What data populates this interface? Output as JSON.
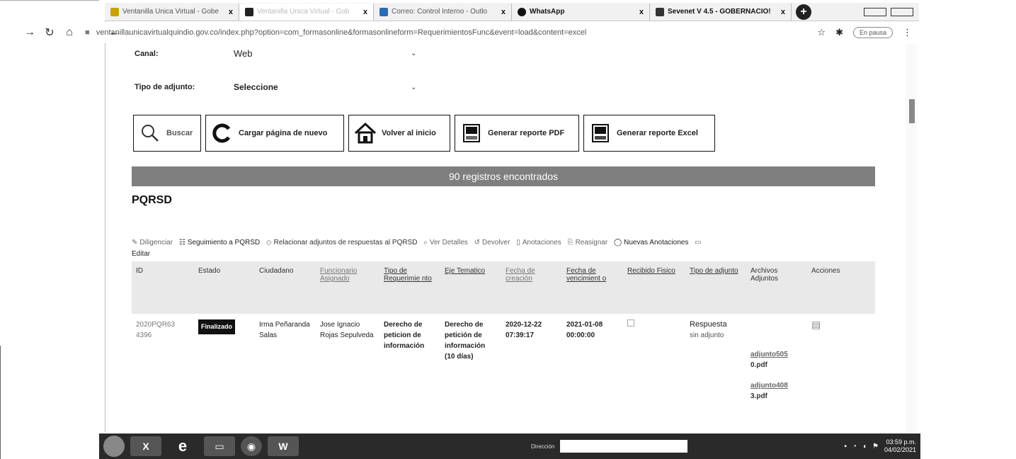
{
  "browser": {
    "tabs": [
      {
        "title": "Ventanilla Única Virtual - Gobe",
        "favicon_color": "#c8a200",
        "active": false
      },
      {
        "title": "Ventanilla Única Virtual - Gob",
        "favicon_color": "#222222",
        "active": true
      },
      {
        "title": "Correo: Control Interno - Outlo",
        "favicon_color": "#2b6cb0",
        "active": false
      },
      {
        "title": "WhatsApp",
        "favicon_color": "#111111",
        "active": false
      },
      {
        "title": "Sevenet V 4.5 - GOBERNACIO!",
        "favicon_color": "#333333",
        "active": false
      }
    ],
    "tab_close": "x",
    "new_tab": "+",
    "url": "ventanillaunicavirtualquindio.gov.co/index.php?option=com_formasonline&formasonlineform=Requerimientos​Func&event=load&content=excel",
    "pause_label": "En pausa"
  },
  "form": {
    "canal_label": "Canal:",
    "canal_value": "Web",
    "adjunto_label": "Tipo de adjunto:",
    "adjunto_value": "Seleccione"
  },
  "buttons": {
    "buscar": "Buscar",
    "recargar": "Cargar página de nuevo",
    "inicio": "Volver al inicio",
    "pdf": "Generar reporte PDF",
    "excel": "Generar reporte Excel"
  },
  "results": {
    "count_text": "90 registros encontrados",
    "section_title": "PQRSD"
  },
  "toolbar": {
    "diligenciar": "Diligenciar",
    "seguimiento": "Seguimiento a PQRSD",
    "relacionar": "Relacionar adjuntos de respuestas al PQRSD",
    "ver_detalles": "Ver Detalles",
    "devolver": "Devolver",
    "anotaciones": "Anotaciones",
    "reasignar": "Reasignar",
    "nuevas_anotaciones": "Nuevas Anotaciones",
    "editar": "Editar"
  },
  "table": {
    "headers": {
      "id": "ID",
      "estado": "Estado",
      "ciudadano": "Ciudadano",
      "funcionario": "Funcionario Asignado",
      "tipo_req": "Tipo de Requerimie nto",
      "eje": "Eje Tematico",
      "fecha_creacion": "Fecha de creación",
      "fecha_venc": "Fecha de vencimient o",
      "recibido": "Recibido Fisico",
      "tipo_adj": "Tipo de adjunto",
      "archivos": "Archivos Adjuntos",
      "acciones": "Acciones"
    },
    "row": {
      "id": "2020PQR63 4396",
      "estado": "Finalizado",
      "ciudadano": "Irma Peñaranda Salas",
      "funcionario": "Jose Ignacio Rojas Sepulveda",
      "tipo_req": "Derecho de peticion de información",
      "eje": "Derecho de petición de información (10 días)",
      "fecha_creacion": "2020-12-22 07:39:17",
      "fecha_venc": "2021-01-08 00:00:00",
      "tipo_adj_1": "Respuesta",
      "tipo_adj_2": "sin adjunto",
      "adjunto_1": "adjunto505",
      "adjunto_1b": "0.pdf",
      "adjunto_2": "adjunto408",
      "adjunto_2b": "3.pdf"
    }
  },
  "taskbar": {
    "direccion_label": "Dirección",
    "clock_time": "03:59 p.m.",
    "clock_date": "04/02/2021"
  }
}
